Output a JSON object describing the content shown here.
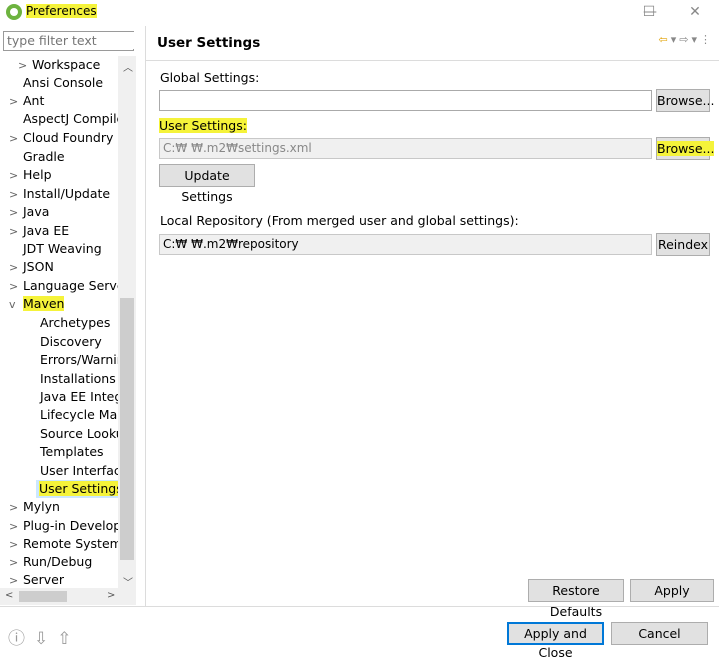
{
  "window": {
    "title": "Preferences",
    "minimize": "—",
    "maximize": "☐",
    "close": "✕"
  },
  "filter": {
    "placeholder": "type filter text"
  },
  "tree": {
    "items": [
      {
        "label": "Workspace",
        "arrow": ">"
      },
      {
        "label": "Ansi Console",
        "arrow": ""
      },
      {
        "label": "Ant",
        "arrow": ">"
      },
      {
        "label": "AspectJ Compiler",
        "arrow": ""
      },
      {
        "label": "Cloud Foundry",
        "arrow": ">"
      },
      {
        "label": "Gradle",
        "arrow": ""
      },
      {
        "label": "Help",
        "arrow": ">"
      },
      {
        "label": "Install/Update",
        "arrow": ">"
      },
      {
        "label": "Java",
        "arrow": ">"
      },
      {
        "label": "Java EE",
        "arrow": ">"
      },
      {
        "label": "JDT Weaving",
        "arrow": ""
      },
      {
        "label": "JSON",
        "arrow": ">"
      },
      {
        "label": "Language Servers",
        "arrow": ">"
      },
      {
        "label": "Maven",
        "arrow": "v"
      },
      {
        "label": "Archetypes",
        "arrow": ""
      },
      {
        "label": "Discovery",
        "arrow": ""
      },
      {
        "label": "Errors/Warnings",
        "arrow": ""
      },
      {
        "label": "Installations",
        "arrow": ""
      },
      {
        "label": "Java EE Integration",
        "arrow": ""
      },
      {
        "label": "Lifecycle Mappings",
        "arrow": ""
      },
      {
        "label": "Source Lookup",
        "arrow": ""
      },
      {
        "label": "Templates",
        "arrow": ""
      },
      {
        "label": "User Interface",
        "arrow": ""
      },
      {
        "label": "User Settings",
        "arrow": ""
      },
      {
        "label": "Mylyn",
        "arrow": ">"
      },
      {
        "label": "Plug-in Development",
        "arrow": ">"
      },
      {
        "label": "Remote Systems",
        "arrow": ">"
      },
      {
        "label": "Run/Debug",
        "arrow": ">"
      },
      {
        "label": "Server",
        "arrow": ">"
      }
    ]
  },
  "page": {
    "title": "User Settings",
    "global_label": "Global Settings:",
    "global_value": "",
    "browse_label": "Browse...",
    "user_label": "User Settings:",
    "user_value": "C:₩              ₩.m2₩settings.xml",
    "update_label": "Update Settings",
    "local_repo_label": "Local Repository (From merged user and global settings):",
    "local_repo_value": "C:₩              ₩.m2₩repository",
    "reindex_label": "Reindex",
    "restore_label": "Restore Defaults",
    "apply_label": "Apply"
  },
  "footer": {
    "apply_close_label": "Apply and Close",
    "cancel_label": "Cancel"
  },
  "colors": {
    "highlight": "#f5f33a",
    "accent": "#0078d7"
  }
}
